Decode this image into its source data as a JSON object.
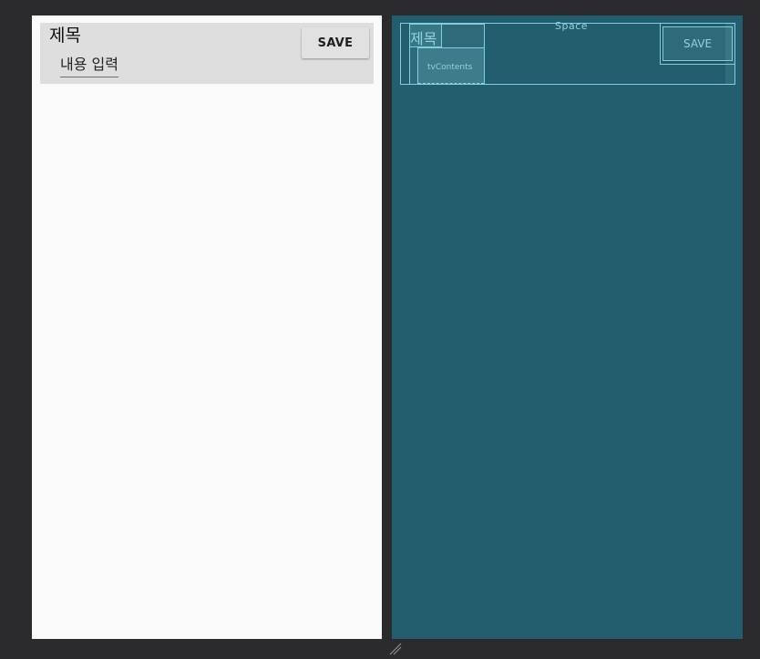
{
  "design": {
    "title": "제목",
    "content": "내용 입력",
    "save_label": "SAVE"
  },
  "blueprint": {
    "space_label": "Space",
    "title_label": "제목",
    "content_label": "tvContents",
    "save_label": "SAVE"
  },
  "colors": {
    "canvas_background": "#2b2b2d",
    "design_background": "#fafafa",
    "design_row_background": "#dedede",
    "blueprint_background": "#235e6e",
    "blueprint_outline": "#7fd0dc"
  },
  "icons": {
    "resize_handle": "resize-handle-icon"
  }
}
